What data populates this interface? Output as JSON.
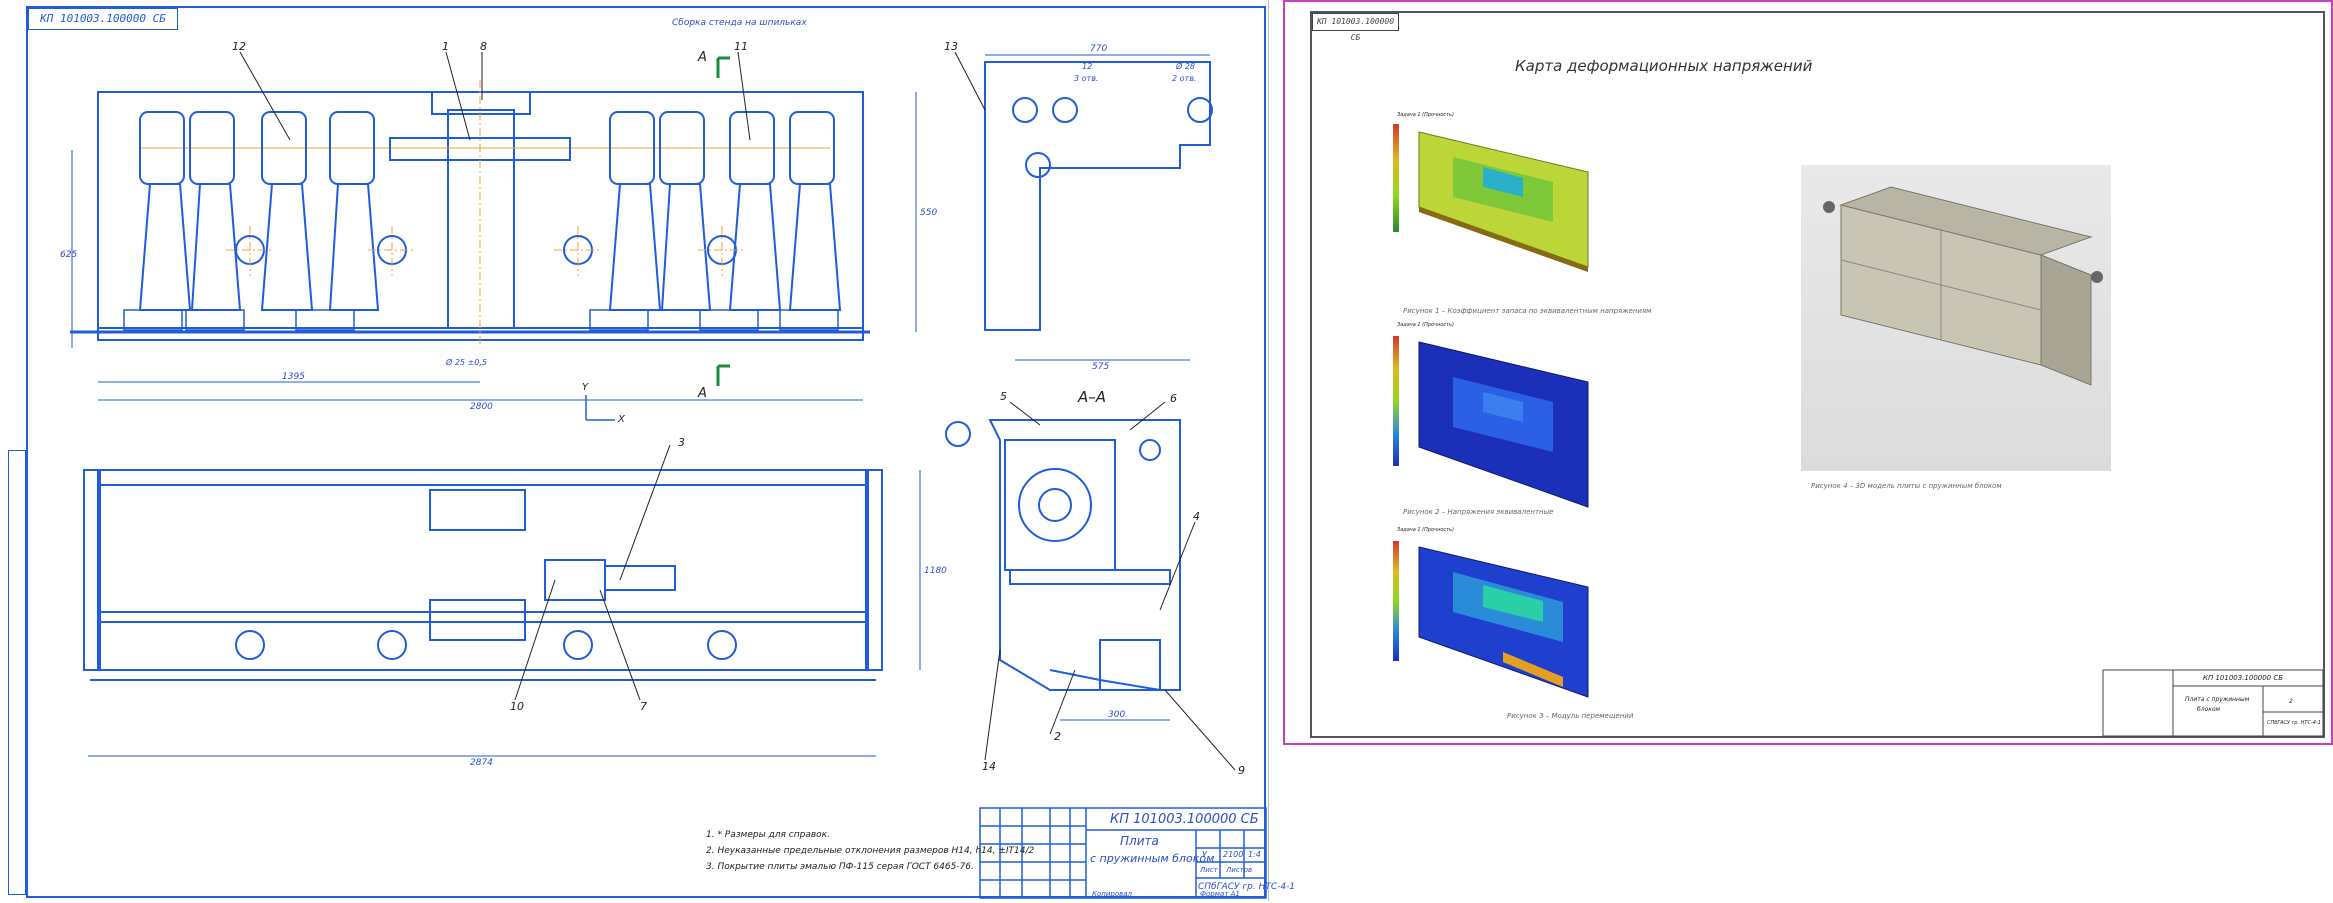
{
  "left_sheet": {
    "doc_code_stamp": "КП 101003.100000 СБ",
    "top_note": "Сборка стенда на шпильках",
    "section_label": "А–А",
    "section_markers": [
      "А",
      "А"
    ],
    "axis_labels": {
      "y": "Y",
      "x": "X"
    },
    "callouts": [
      "1",
      "2",
      "3",
      "4",
      "5",
      "6",
      "7",
      "8",
      "9",
      "10",
      "11",
      "12",
      "13",
      "14"
    ],
    "dimensions": {
      "d_width_total": "2800",
      "d_width_lower": "2874",
      "d_half": "1395",
      "d_height_left": "625",
      "d_height_right": "550",
      "d_height_lower": "1180",
      "d_side_top": "770",
      "d_side_bottom": "575",
      "d_side_hole1": "12",
      "d_side_hole2": "3 отв.",
      "d_side_hole3": "Ø 28",
      "d_side_hole4": "2 отв.",
      "d_section_bottom": "300",
      "d_center": "Ø 25 ±0,5"
    },
    "notes": [
      "1. * Размеры для справок.",
      "2. Неуказанные предельные отклонения размеров Н14, h14, ±IT14/2",
      "3. Покрытие плиты эмалью ПФ-115 серая ГОСТ 6465-76."
    ],
    "title_block": {
      "doc_number": "КП 101003.100000 СБ",
      "name_line1": "Плита",
      "name_line2": "с пружинным блоком",
      "stage_letter": "У",
      "mass": "2100",
      "scale": "1:4",
      "sheet_label": "Лист",
      "sheets_label": "Листов",
      "org": "СПбГАСУ гр. НТС-4-1",
      "copy_label": "Копировал",
      "format_label": "Формат A1"
    }
  },
  "right_sheet": {
    "doc_code_stamp": "КП 101003.100000 СБ",
    "title": "Карта деформационных напряжений",
    "figures": [
      {
        "caption": "Рисунок 1 – Коэффициент запаса по эквивалентным напряжениям",
        "legend_title": "Задача 1 (Прочность)",
        "colors": [
          "#d03a2f",
          "#e0b820",
          "#8ed820",
          "#2a8a2a"
        ]
      },
      {
        "caption": "Рисунок 2 – Напряжения эквивалентные",
        "legend_title": "Задача 1 (Прочность)",
        "colors": [
          "#1c2fb8",
          "#2b5fe6",
          "#3a7ef0",
          "#1b3fd0"
        ]
      },
      {
        "caption": "Рисунок 3 – Модуль перемещений",
        "legend_title": "Задача 1 (Прочность)",
        "colors": [
          "#1f3fcf",
          "#2a8bd8",
          "#2acfa8",
          "#e6a020"
        ]
      }
    ],
    "render_caption": "Рисунок 4 – 3D модель плиты с пружинным блоком",
    "title_block": {
      "doc_number": "КП 101003.100000 СБ",
      "name_line1": "Плита с пружинным",
      "name_line2": "блоком",
      "org": "СПбГАСУ гр. НТС-4-1",
      "sheet": "2"
    }
  }
}
